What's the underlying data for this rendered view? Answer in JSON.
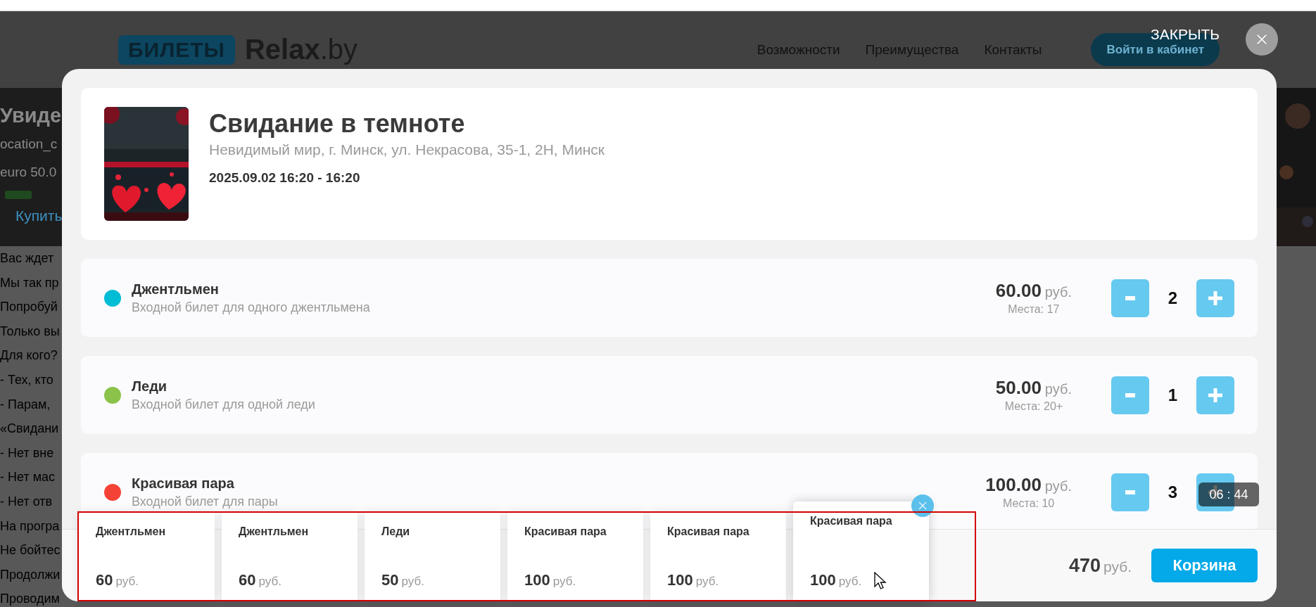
{
  "site": {
    "logo": {
      "badge": "БИЛЕТЫ",
      "name": "**Relax**.by"
    },
    "nav": [
      "Возможности",
      "Преимущества",
      "Контакты"
    ],
    "login_button": "Войти в кабинет",
    "hero": {
      "title": "Увиде",
      "subtitle": "ocation_c",
      "price": "euro 50.0",
      "buy_link": "Купить"
    },
    "body_lines": [
      "Вас ждет",
      "Мы так пр",
      "Попробуй",
      "Только вы",
      "Для кого?",
      "- Тех, кто",
      "- Парам,",
      "«Свидани",
      "- Нет вне",
      "- Нет мас",
      "- Нет отв",
      "На програ",
      "Не бойтес",
      "Продолжи",
      "Проводим"
    ]
  },
  "modal": {
    "close_label": "ЗАКРЫТЬ",
    "event": {
      "title": "Свидание в темноте",
      "venue": "Невидимый мир, г. Минск, ул. Некрасова, 35-1, 2Н, Минск",
      "datetime": "2025.09.02 16:20 - 16:20"
    },
    "tickets": [
      {
        "name": "Джентльмен",
        "description": "Входной билет для одного джентльмена",
        "price": "60.00",
        "currency": "руб.",
        "seats": "Места: 17",
        "quantity": "2",
        "color": "#00bcd4"
      },
      {
        "name": "Леди",
        "description": "Входной билет для одной леди",
        "price": "50.00",
        "currency": "руб.",
        "seats": "Места: 20+",
        "quantity": "1",
        "color": "#8bc34a"
      },
      {
        "name": "Красивая пара",
        "description": "Входной билет для пары",
        "price": "100.00",
        "currency": "руб.",
        "seats": "Места: 10",
        "quantity": "3",
        "color": "#f44336"
      }
    ],
    "timer": "06 : 44",
    "total": {
      "amount": "470",
      "currency": "руб."
    },
    "cart_button": "Корзина"
  },
  "cart_preview": {
    "items": [
      {
        "name": "Джентльмен",
        "price": "60",
        "currency": "руб.",
        "hovered": false
      },
      {
        "name": "Джентльмен",
        "price": "60",
        "currency": "руб.",
        "hovered": false
      },
      {
        "name": "Леди",
        "price": "50",
        "currency": "руб.",
        "hovered": false
      },
      {
        "name": "Красивая пара",
        "price": "100",
        "currency": "руб.",
        "hovered": false
      },
      {
        "name": "Красивая пара",
        "price": "100",
        "currency": "руб.",
        "hovered": false
      },
      {
        "name": "Красивая пара",
        "price": "100",
        "currency": "руб.",
        "hovered": true
      }
    ]
  }
}
